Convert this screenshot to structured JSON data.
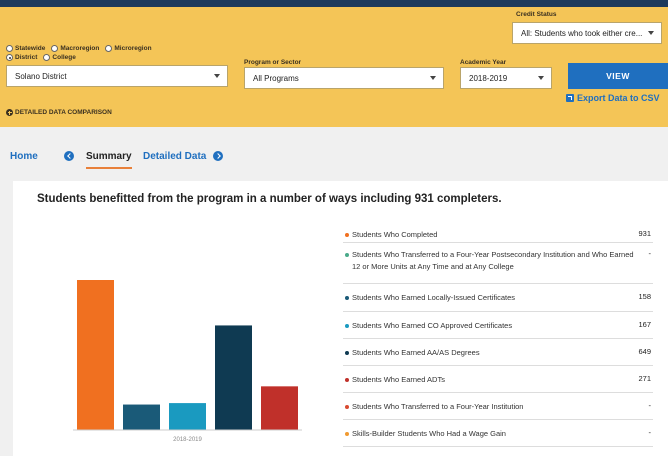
{
  "credit_status": {
    "label": "Credit Status",
    "value": "All: Students who took either cre..."
  },
  "geography": {
    "options": [
      "Statewide",
      "Macroregion",
      "Microregion",
      "District",
      "College"
    ],
    "selected": "District"
  },
  "district_select": {
    "value": "Solano District"
  },
  "program": {
    "label": "Program or Sector",
    "value": "All Programs"
  },
  "academic_year": {
    "label": "Academic Year",
    "value": "2018-2019"
  },
  "view_label": "VIEW",
  "export_label": "Export Data to CSV",
  "detail_label": "DETAILED DATA COMPARISON",
  "tabs": {
    "home": "Home",
    "summary": "Summary",
    "detailed": "Detailed Data"
  },
  "headline": "Students benefitted from the program in a number of ways including 931 completers.",
  "chart_data": {
    "type": "bar",
    "categories": [
      "2018-2019"
    ],
    "series": [
      {
        "name": "Students Who Completed",
        "color": "#f07020",
        "values": [
          931
        ]
      },
      {
        "name": "Students Who Earned Locally-Issued Certificates",
        "color": "#1a5a78",
        "values": [
          158
        ]
      },
      {
        "name": "Students Who Earned CO Approved Certificates",
        "color": "#1a9ac0",
        "values": [
          167
        ]
      },
      {
        "name": "Students Who Earned AA/AS Degrees",
        "color": "#0f3a52",
        "values": [
          649
        ]
      },
      {
        "name": "Students Who Earned ADTs",
        "color": "#c0302a",
        "values": [
          271
        ]
      }
    ],
    "xlabel": "",
    "ylabel": "",
    "ylim": [
      0,
      931
    ],
    "grid": false
  },
  "metrics": [
    {
      "label": "Students Who Completed",
      "value": "931",
      "color": "#f07020"
    },
    {
      "label": "Students Who Transferred to a Four-Year Postsecondary Institution and Who Earned 12 or More Units at Any Time and at Any College",
      "value": "-",
      "color": "#4aaa8a"
    },
    {
      "label": "Students Who Earned Locally-Issued Certificates",
      "value": "158",
      "color": "#1a5a78"
    },
    {
      "label": "Students Who Earned CO Approved Certificates",
      "value": "167",
      "color": "#1a9ac0"
    },
    {
      "label": "Students Who Earned AA/AS Degrees",
      "value": "649",
      "color": "#0f3a52"
    },
    {
      "label": "Students Who Earned ADTs",
      "value": "271",
      "color": "#c0302a"
    },
    {
      "label": "Students Who Transferred to a Four-Year Institution",
      "value": "-",
      "color": "#d84a30"
    },
    {
      "label": "Skills-Builder Students Who Had a Wage Gain",
      "value": "-",
      "color": "#f09a30"
    }
  ]
}
